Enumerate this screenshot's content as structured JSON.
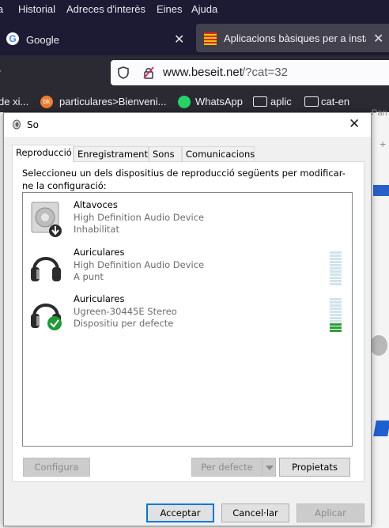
{
  "browser": {
    "menu": [
      "ia",
      "Historial",
      "Adreces d'interès",
      "Eines",
      "Ajuda"
    ],
    "tabs": [
      {
        "label": "Google"
      },
      {
        "label": "Aplicacions bàsiques per a instal"
      }
    ],
    "url": {
      "domain": "www.beseit.net",
      "path": "/?cat=32"
    },
    "bookmarks": [
      "de xi...",
      "particulares>Bienveni...",
      "WhatsApp",
      "aplic",
      "cat-en"
    ],
    "right_edge_text": "Pan"
  },
  "dialog": {
    "title": "So",
    "tabs": [
      "Reproducció",
      "Enregistrament",
      "Sons",
      "Comunicacions"
    ],
    "instructions": "Seleccioneu un dels dispositius de reproducció següents per modificar-ne la configuració:",
    "devices": [
      {
        "name": "Altavoces",
        "description": "High Definition Audio Device",
        "status": "Inhabilitat",
        "icon": "speaker-disabled-icon"
      },
      {
        "name": "Auriculares",
        "description": "High Definition Audio Device",
        "status": "A punt",
        "icon": "headphones-icon"
      },
      {
        "name": "Auriculares",
        "description": "Ugreen-30445E Stereo",
        "status": "Dispositiu per defecte",
        "icon": "headphones-default-icon",
        "level": 0.3
      }
    ],
    "buttons": {
      "configure": "Configura",
      "set_default": "Per defecte",
      "properties": "Propietats",
      "ok": "Acceptar",
      "cancel": "Cancel·lar",
      "apply": "Aplicar"
    }
  }
}
